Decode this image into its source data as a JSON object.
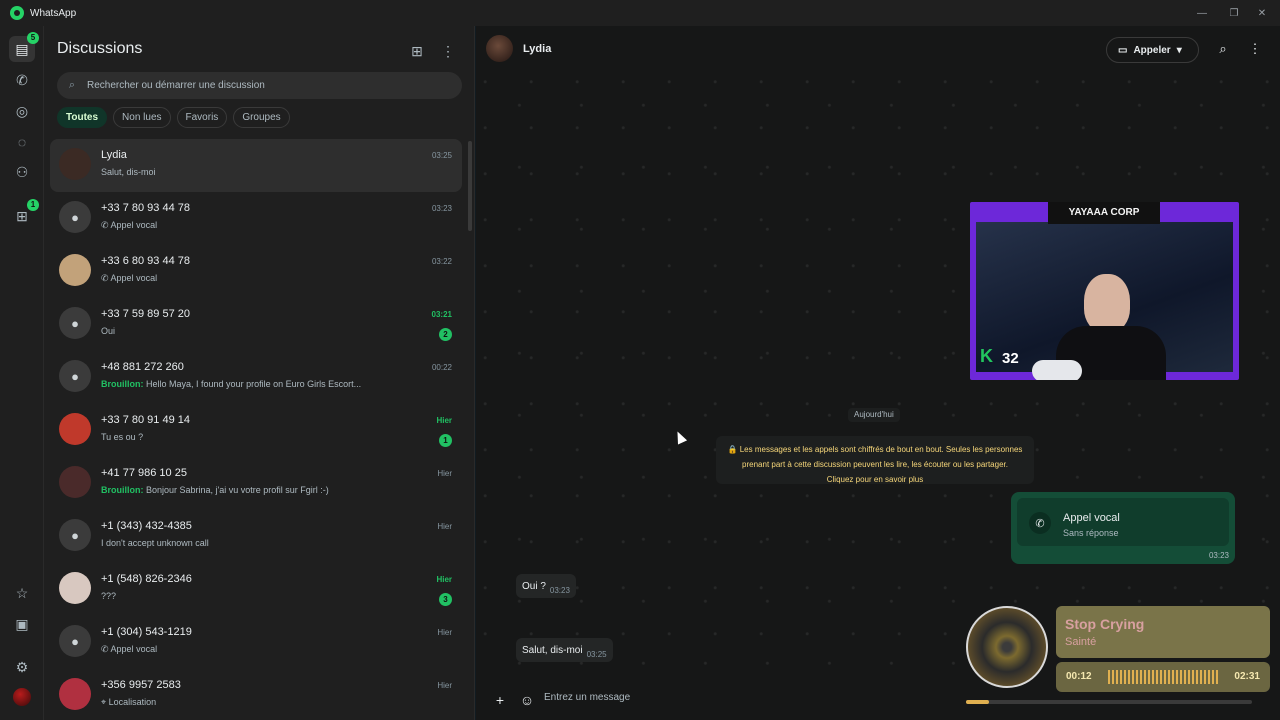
{
  "window": {
    "title": "WhatsApp",
    "controls": [
      "minimize-icon",
      "restore-icon",
      "close-icon"
    ]
  },
  "rail": {
    "items": [
      {
        "name": "chats",
        "icon": "chat-icon",
        "badge": "5"
      },
      {
        "name": "calls",
        "icon": "phone-icon",
        "badge": ""
      },
      {
        "name": "status",
        "icon": "status-icon",
        "badge": ""
      },
      {
        "name": "channels",
        "icon": "channels-icon",
        "badge": ""
      },
      {
        "name": "communities",
        "icon": "communities-icon",
        "badge": ""
      },
      {
        "name": "archived",
        "icon": "archive-icon",
        "badge": "1"
      }
    ],
    "bottom": [
      "starred-icon",
      "media-icon",
      "settings-icon",
      "profile-avatar"
    ]
  },
  "sidebar": {
    "title": "Discussions",
    "search_placeholder": "Rechercher ou démarrer une discussion",
    "filters": [
      {
        "label": "Toutes",
        "active": true
      },
      {
        "label": "Non lues",
        "active": false
      },
      {
        "label": "Favoris",
        "active": false
      },
      {
        "label": "Groupes",
        "active": false
      }
    ],
    "chats": [
      {
        "name": "Lydia",
        "preview": "Salut, dis-moi",
        "draft": "",
        "icon": "",
        "time": "03:25",
        "unread": "",
        "time_unread": false,
        "avatar_color": "#3b2a24",
        "selected": true
      },
      {
        "name": "+33 7 80 93 44 78",
        "preview": "Appel vocal",
        "draft": "",
        "icon": "call-icon",
        "time": "03:23",
        "unread": "",
        "time_unread": false,
        "avatar_color": "",
        "selected": false
      },
      {
        "name": "+33 6 80 93 44 78",
        "preview": "Appel vocal",
        "draft": "",
        "icon": "call-icon",
        "time": "03:22",
        "unread": "",
        "time_unread": false,
        "avatar_color": "#c2a27a",
        "selected": false
      },
      {
        "name": "+33 7 59 89 57 20",
        "preview": "Oui",
        "draft": "",
        "icon": "",
        "time": "03:21",
        "unread": "2",
        "time_unread": true,
        "avatar_color": "",
        "selected": false
      },
      {
        "name": "+48 881 272 260",
        "preview": "Hello Maya, I found your profile on Euro Girls Escort...",
        "draft": "Brouillon:",
        "icon": "",
        "time": "00:22",
        "unread": "",
        "time_unread": false,
        "avatar_color": "",
        "selected": false
      },
      {
        "name": "+33 7 80 91 49 14",
        "preview": "Tu es ou ?",
        "draft": "",
        "icon": "",
        "time": "Hier",
        "unread": "1",
        "time_unread": true,
        "avatar_color": "#c0392b",
        "selected": false
      },
      {
        "name": "+41 77 986 10 25",
        "preview": "Bonjour Sabrina, j'ai vu votre profil sur Fgirl :-)",
        "draft": "Brouillon:",
        "icon": "",
        "time": "Hier",
        "unread": "",
        "time_unread": false,
        "avatar_color": "#4a2a2a",
        "selected": false
      },
      {
        "name": "+1 (343) 432-4385",
        "preview": "I don't accept unknown call",
        "draft": "",
        "icon": "",
        "time": "Hier",
        "unread": "",
        "time_unread": false,
        "avatar_color": "",
        "selected": false
      },
      {
        "name": "+1 (548) 826-2346",
        "preview": "???",
        "draft": "",
        "icon": "",
        "time": "Hier",
        "unread": "3",
        "time_unread": true,
        "avatar_color": "#d8c8c0",
        "selected": false
      },
      {
        "name": "+1 (304) 543-1219",
        "preview": "Appel vocal",
        "draft": "",
        "icon": "call-icon",
        "time": "Hier",
        "unread": "",
        "time_unread": false,
        "avatar_color": "",
        "selected": false
      },
      {
        "name": "+356 9957 2583",
        "preview": "Localisation",
        "draft": "",
        "icon": "location-icon",
        "time": "Hier",
        "unread": "",
        "time_unread": false,
        "avatar_color": "#b03040",
        "selected": false
      }
    ]
  },
  "conversation": {
    "contact_name": "Lydia",
    "call_button": "Appeler",
    "stream_overlay": {
      "banner": "YAYAAA CORP",
      "k_label": "K",
      "k_value": "32"
    },
    "day_separator": "Aujourd'hui",
    "encryption_notice": "🔒 Les messages et les appels sont chiffrés de bout en bout. Seules les personnes prenant part à cette discussion peuvent les lire, les écouter ou les partager.",
    "encryption_link": "Cliquez pour en savoir plus",
    "call_message": {
      "title": "Appel vocal",
      "status": "Sans réponse",
      "time": "03:23"
    },
    "incoming": [
      {
        "text": "Oui ?",
        "time": "03:23"
      },
      {
        "text": "Salut, dis-moi",
        "time": "03:25"
      }
    ],
    "composer_placeholder": "Entrez un message"
  },
  "music_widget": {
    "song": "Stop Crying",
    "artist": "Sainté",
    "current_time": "00:12",
    "total_time": "02:31",
    "progress": 0.08
  }
}
